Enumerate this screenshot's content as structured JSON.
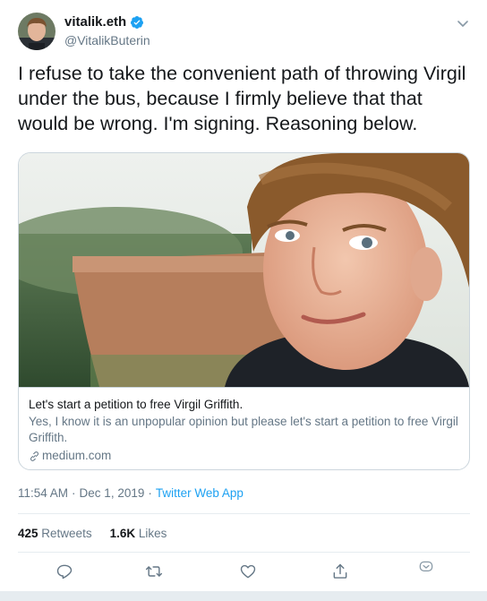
{
  "user": {
    "display_name": "vitalik.eth",
    "handle": "@VitalikButerin"
  },
  "tweet": {
    "text": "I refuse to take the convenient path of throwing Virgil under the bus, because I firmly believe that that would be wrong. I'm signing. Reasoning below."
  },
  "card": {
    "title": "Let's start a petition to free Virgil Griffith.",
    "description": "Yes, I know it is an unpopular opinion but please let's start a petition to free Virgil Griffith.",
    "domain": "medium.com"
  },
  "meta": {
    "time": "11:54 AM",
    "separator": "·",
    "date": "Dec 1, 2019",
    "source": "Twitter Web App"
  },
  "stats": {
    "retweets_count": "425",
    "retweets_label": "Retweets",
    "likes_count": "1.6K",
    "likes_label": "Likes"
  },
  "icons": {
    "verified": "verified-badge-icon",
    "caret": "chevron-down-icon",
    "reply": "reply-icon",
    "retweet": "retweet-icon",
    "like": "heart-icon",
    "share": "share-icon",
    "analytics": "chevron-circle-icon"
  },
  "colors": {
    "brand_blue": "#1da1f2",
    "text_primary": "#14171a",
    "text_secondary": "#657786",
    "border": "#ccd6dd"
  }
}
